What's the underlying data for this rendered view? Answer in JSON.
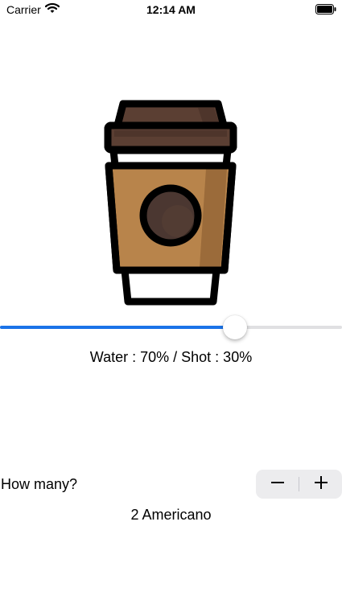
{
  "status_bar": {
    "carrier": "Carrier",
    "time": "12:14 AM",
    "wifi_icon": "wifi-icon",
    "battery_icon": "battery-icon"
  },
  "illustration": {
    "icon": "coffee-cup-icon",
    "colors": {
      "lid": "#5b3f33",
      "sleeve": "#b8844b",
      "sleeve_shade": "#9b6b3a",
      "logo": "#4b3731",
      "outline": "#000000"
    }
  },
  "slider": {
    "value": 0.7,
    "accent_color": "#1a73e8"
  },
  "ratio_text": "Water : 70% / Shot : 30%",
  "quantity": {
    "prompt": "How many?",
    "minus_icon": "minus-icon",
    "plus_icon": "plus-icon",
    "summary": "2 Americano"
  }
}
